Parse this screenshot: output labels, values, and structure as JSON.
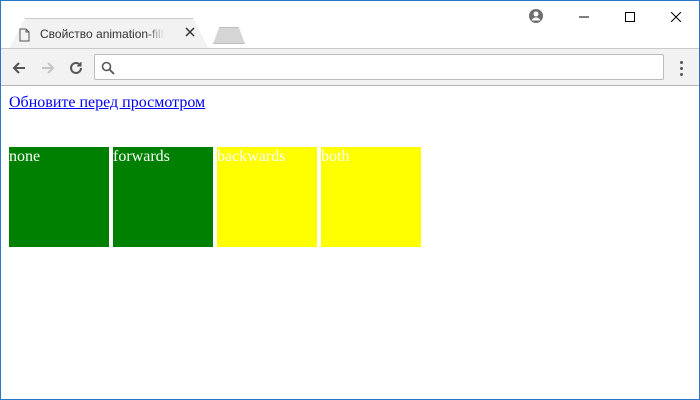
{
  "browser": {
    "tab_title": "Свойство animation-fill-mode",
    "address_value": ""
  },
  "icons": {
    "tab": "page-icon",
    "tab_close": "close-icon",
    "profile": "profile-icon",
    "minimize": "minimize-icon",
    "maximize": "maximize-icon",
    "close": "close-icon",
    "back": "back-arrow-icon",
    "forward": "forward-arrow-icon",
    "reload": "reload-icon",
    "search": "search-icon",
    "menu": "menu-dots-icon"
  },
  "page": {
    "refresh_link": "Обновите перед просмотром",
    "boxes": [
      {
        "label": "none",
        "color": "#008000"
      },
      {
        "label": "forwards",
        "color": "#008000"
      },
      {
        "label": "backwards",
        "color": "#ffff00"
      },
      {
        "label": "both",
        "color": "#ffff00"
      }
    ]
  },
  "colors": {
    "window_border": "#2b78c8",
    "link": "#0000ee"
  }
}
